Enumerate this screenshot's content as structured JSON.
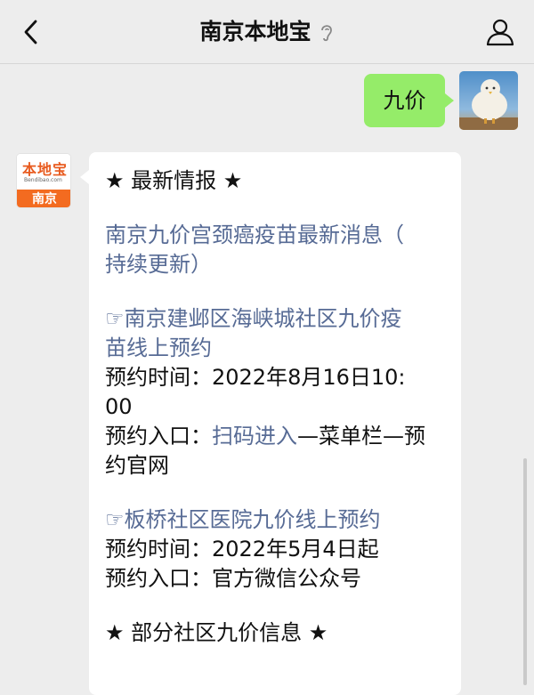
{
  "header": {
    "title": "南京本地宝",
    "back_icon": "back-chevron-icon",
    "ear_icon": "ear-icon",
    "user_icon": "user-profile-icon"
  },
  "messages": {
    "outgoing": {
      "text": "九价",
      "avatar": "bird-avatar"
    },
    "incoming": {
      "avatar": {
        "brand": "本地宝",
        "site": "Bendibao.com",
        "city": "南京"
      },
      "section1": "★ 最新情报 ★",
      "news_link_1": "南京九价宫颈癌疫苗最新消息（",
      "news_link_2": "持续更新）",
      "item1_title_1": "☞南京建邺区海峡城社区九价疫",
      "item1_title_2": "苗线上预约",
      "item1_time_1": "预约时间：2022年8月16日10:",
      "item1_time_2": "00",
      "item1_entry_prefix": "预约入口：",
      "item1_entry_link": "扫码进入",
      "item1_entry_suffix": "—菜单栏—预",
      "item1_entry_2": "约官网",
      "item2_title": "☞板桥社区医院九价线上预约",
      "item2_time": "预约时间：2022年5月4日起",
      "item2_entry": "预约入口：官方微信公众号",
      "section2": "★ 部分社区九价信息 ★"
    }
  },
  "colors": {
    "background": "#ededed",
    "outgoing_bubble": "#95ec69",
    "incoming_bubble": "#ffffff",
    "link": "#576b95",
    "brand_orange": "#f36b20"
  }
}
